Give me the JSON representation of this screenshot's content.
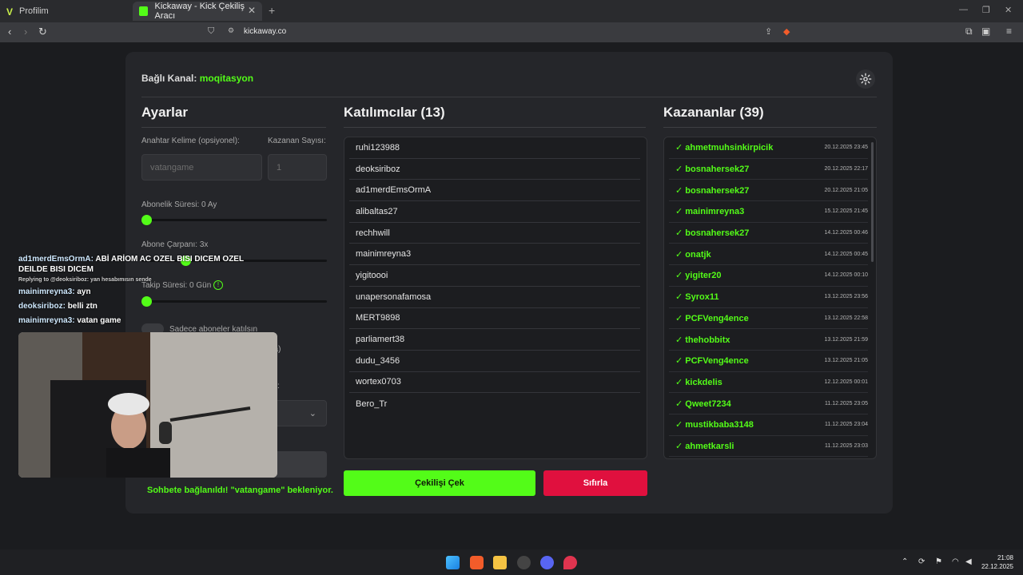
{
  "browser": {
    "tabs": [
      {
        "label": "Profilim"
      },
      {
        "label": "Kickaway - Kick Çekiliş Aracı"
      }
    ],
    "new_tab": "+",
    "url": "kickaway.co"
  },
  "page": {
    "connected_label": "Bağlı Kanal:",
    "connected_channel": "moqitasyon",
    "settings": {
      "title": "Ayarlar",
      "keyword_label": "Anahtar Kelime (opsiyonel):",
      "keyword_placeholder": "vatangame",
      "winners_label": "Kazanan Sayısı:",
      "winners_value": "1",
      "sub_duration_label": "Abonelik Süresi: 0 Ay",
      "sub_multiplier_label": "Abone Çarpanı: 3x",
      "follow_duration_label": "Takip Süresi: 0 Gün",
      "follow_info_icon": "!",
      "only_subs_label": "Sadece aboneler katılsın",
      "partial_label": "da)",
      "partial_label2": "k:",
      "sub_duration_value": 0,
      "sub_multiplier_value": 3,
      "follow_duration_value": 0
    },
    "participants": {
      "title": "Katılımcılar (13)",
      "items": [
        "ruhi123988",
        "deoksiriboz",
        "ad1merdEmsOrmA",
        "alibaltas27",
        "rechhwill",
        "mainimreyna3",
        "yigitoooi",
        "unapersonafamosa",
        "MERT9898",
        "parliamert38",
        "dudu_3456",
        "wortex0703",
        "Bero_Tr"
      ]
    },
    "winners": {
      "title": "Kazananlar (39)",
      "items": [
        {
          "name": "✓ ahmetmuhsinkirpicik",
          "date": "20.12.2025 23:45"
        },
        {
          "name": "✓ bosnahersek27",
          "date": "20.12.2025 22:17"
        },
        {
          "name": "✓ bosnahersek27",
          "date": "20.12.2025 21:05"
        },
        {
          "name": "✓ mainimreyna3",
          "date": "15.12.2025 21:45"
        },
        {
          "name": "✓ bosnahersek27",
          "date": "14.12.2025 00:46"
        },
        {
          "name": "✓ onatjk",
          "date": "14.12.2025 00:45"
        },
        {
          "name": "✓ yigiter20",
          "date": "14.12.2025 00:10"
        },
        {
          "name": "✓ Syrox11",
          "date": "13.12.2025 23:56"
        },
        {
          "name": "✓ PCFVeng4ence",
          "date": "13.12.2025 22:58"
        },
        {
          "name": "✓ thehobbitx",
          "date": "13.12.2025 21:59"
        },
        {
          "name": "✓ PCFVeng4ence",
          "date": "13.12.2025 21:05"
        },
        {
          "name": "✓ kickdelis",
          "date": "12.12.2025 00:01"
        },
        {
          "name": "✓ Qweet7234",
          "date": "11.12.2025 23:05"
        },
        {
          "name": "✓ mustikbaba3148",
          "date": "11.12.2025 23:04"
        },
        {
          "name": "✓ ahmetkarsli",
          "date": "11.12.2025 23:03"
        }
      ]
    },
    "draw_button": "Çekilişi Çek",
    "reset_button": "Sıfırla",
    "status": "Sohbete bağlanıldı! \"vatangame\" bekleniyor."
  },
  "chat_overlay": [
    {
      "user": "ad1merdEmsOrmA:",
      "text": "ABİ ARİOM AC OZEL BISI DICEM OZEL DEILDE BISI DICEM"
    },
    {
      "reply": "Replying to @deoksiriboz: yan hesabımısın sende"
    },
    {
      "user": "mainimreyna3:",
      "text": "ayn"
    },
    {
      "user": "deoksiriboz:",
      "text": "belli ztn"
    },
    {
      "user": "mainimreyna3:",
      "text": "vatan game"
    }
  ],
  "taskbar": {
    "time": "21:08",
    "date": "22.12.2025"
  },
  "colors": {
    "accent": "#53fc18",
    "reset": "#e0103e",
    "card": "#25262a",
    "background": "#1b1c1f"
  }
}
